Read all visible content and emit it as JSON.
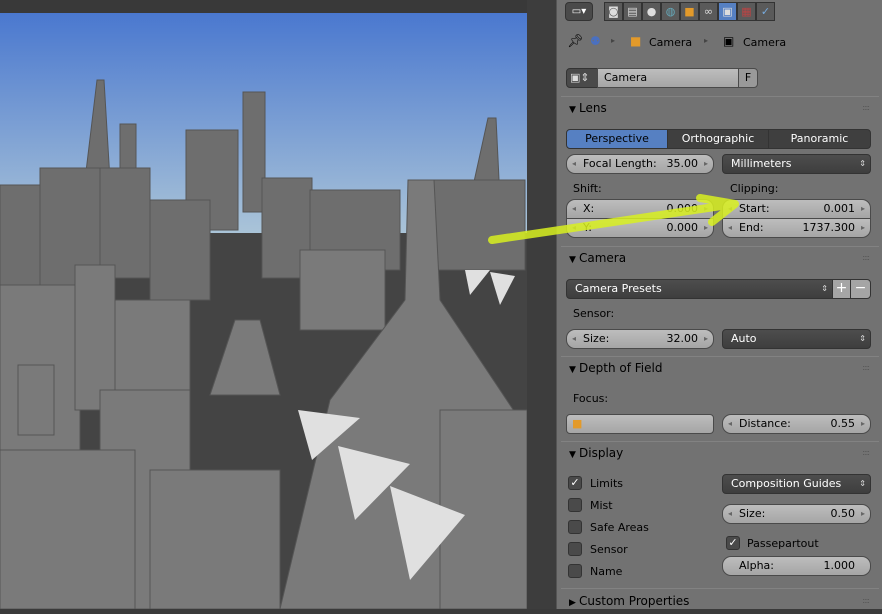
{
  "header": {
    "icons": [
      "render-icon",
      "render-layers-icon",
      "scene-icon",
      "world-icon",
      "object-icon",
      "constraints-icon",
      "camera-data-icon",
      "texture-icon",
      "particles-icon"
    ],
    "active_icon": "camera-data-icon"
  },
  "breadcrumb": {
    "items": [
      "Camera",
      "Camera"
    ]
  },
  "datablock": {
    "name": "Camera",
    "fake_user": "F"
  },
  "lens": {
    "title": "Lens",
    "tabs": [
      "Perspective",
      "Orthographic",
      "Panoramic"
    ],
    "active_tab": "Perspective",
    "focal_label": "Focal Length:",
    "focal_value": "35.00",
    "unit": "Millimeters",
    "shift_label": "Shift:",
    "shift_x_label": "X:",
    "shift_x": "0.000",
    "shift_y_label": "Y:",
    "shift_y": "0.000",
    "clip_label": "Clipping:",
    "start_label": "Start:",
    "start": "0.001",
    "end_label": "End:",
    "end": "1737.300"
  },
  "camera": {
    "title": "Camera",
    "presets": "Camera Presets",
    "sensor_label": "Sensor:",
    "size_label": "Size:",
    "size": "32.00",
    "fit": "Auto"
  },
  "dof": {
    "title": "Depth of Field",
    "focus_label": "Focus:",
    "distance_label": "Distance:",
    "distance": "0.55"
  },
  "display": {
    "title": "Display",
    "checks": [
      {
        "label": "Limits",
        "checked": true
      },
      {
        "label": "Mist",
        "checked": false
      },
      {
        "label": "Safe Areas",
        "checked": false
      },
      {
        "label": "Sensor",
        "checked": false
      },
      {
        "label": "Name",
        "checked": false
      }
    ],
    "guides": "Composition Guides",
    "size_label": "Size:",
    "size": "0.50",
    "passepartout": "Passepartout",
    "alpha_label": "Alpha:",
    "alpha": "1.000"
  },
  "custom": {
    "title": "Custom Properties"
  },
  "colors": {
    "accent": "#5680c2",
    "annotation": "#d8f020",
    "panel": "#727272"
  }
}
